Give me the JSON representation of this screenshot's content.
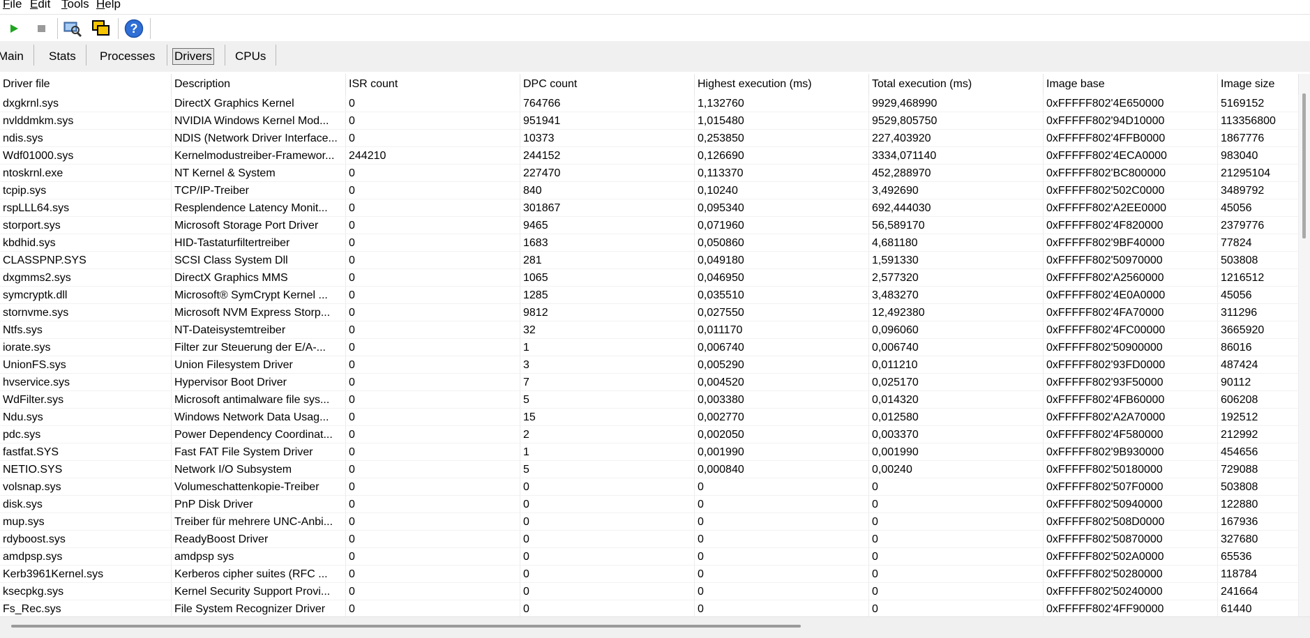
{
  "menu": [
    {
      "accel": "F",
      "rest": "ile"
    },
    {
      "accel": "E",
      "rest": "dit"
    },
    {
      "accel": "T",
      "rest": "ools"
    },
    {
      "accel": "H",
      "rest": "elp"
    }
  ],
  "toolbar": {
    "icons": [
      "play-icon",
      "stop-icon",
      "search-tool-icon",
      "windows-icon",
      "help-icon"
    ],
    "colors": {
      "play": "#1fa51f",
      "stop": "#9a9a9a",
      "help": "#2f6fd6"
    },
    "help_glyph": "?"
  },
  "tabs": [
    {
      "label": "Main",
      "selected": false
    },
    {
      "label": "Stats",
      "selected": false
    },
    {
      "label": "Processes",
      "selected": false
    },
    {
      "label": "Drivers",
      "selected": true
    },
    {
      "label": "CPUs",
      "selected": false
    }
  ],
  "table": {
    "columns": [
      "Driver file",
      "Description",
      "ISR count",
      "DPC count",
      "Highest execution (ms)",
      "Total execution (ms)",
      "Image base",
      "Image size"
    ],
    "rows": [
      [
        "dxgkrnl.sys",
        "DirectX Graphics Kernel",
        "0",
        "764766",
        "1,132760",
        "9929,468990",
        "0xFFFFF802'4E650000",
        "5169152"
      ],
      [
        "nvlddmkm.sys",
        "NVIDIA Windows Kernel Mod...",
        "0",
        "951941",
        "1,015480",
        "9529,805750",
        "0xFFFFF802'94D10000",
        "113356800"
      ],
      [
        "ndis.sys",
        "NDIS (Network Driver Interface...",
        "0",
        "10373",
        "0,253850",
        "227,403920",
        "0xFFFFF802'4FFB0000",
        "1867776"
      ],
      [
        "Wdf01000.sys",
        "Kernelmodustreiber-Framewor...",
        "244210",
        "244152",
        "0,126690",
        "3334,071140",
        "0xFFFFF802'4ECA0000",
        "983040"
      ],
      [
        "ntoskrnl.exe",
        "NT Kernel & System",
        "0",
        "227470",
        "0,113370",
        "452,288970",
        "0xFFFFF802'BC800000",
        "21295104"
      ],
      [
        "tcpip.sys",
        "TCP/IP-Treiber",
        "0",
        "840",
        "0,10240",
        "3,492690",
        "0xFFFFF802'502C0000",
        "3489792"
      ],
      [
        "rspLLL64.sys",
        "Resplendence Latency Monit...",
        "0",
        "301867",
        "0,095340",
        "692,444030",
        "0xFFFFF802'A2EE0000",
        "45056"
      ],
      [
        "storport.sys",
        "Microsoft Storage Port Driver",
        "0",
        "9465",
        "0,071960",
        "56,589170",
        "0xFFFFF802'4F820000",
        "2379776"
      ],
      [
        "kbdhid.sys",
        "HID-Tastaturfiltertreiber",
        "0",
        "1683",
        "0,050860",
        "4,681180",
        "0xFFFFF802'9BF40000",
        "77824"
      ],
      [
        "CLASSPNP.SYS",
        "SCSI Class System Dll",
        "0",
        "281",
        "0,049180",
        "1,591330",
        "0xFFFFF802'50970000",
        "503808"
      ],
      [
        "dxgmms2.sys",
        "DirectX Graphics MMS",
        "0",
        "1065",
        "0,046950",
        "2,577320",
        "0xFFFFF802'A2560000",
        "1216512"
      ],
      [
        "symcryptk.dll",
        "Microsoft® SymCrypt Kernel ...",
        "0",
        "1285",
        "0,035510",
        "3,483270",
        "0xFFFFF802'4E0A0000",
        "45056"
      ],
      [
        "stornvme.sys",
        "Microsoft NVM Express Storp...",
        "0",
        "9812",
        "0,027550",
        "12,492380",
        "0xFFFFF802'4FA70000",
        "311296"
      ],
      [
        "Ntfs.sys",
        "NT-Dateisystemtreiber",
        "0",
        "32",
        "0,011170",
        "0,096060",
        "0xFFFFF802'4FC00000",
        "3665920"
      ],
      [
        "iorate.sys",
        "Filter zur Steuerung der E/A-...",
        "0",
        "1",
        "0,006740",
        "0,006740",
        "0xFFFFF802'50900000",
        "86016"
      ],
      [
        "UnionFS.sys",
        "Union Filesystem Driver",
        "0",
        "3",
        "0,005290",
        "0,011210",
        "0xFFFFF802'93FD0000",
        "487424"
      ],
      [
        "hvservice.sys",
        "Hypervisor Boot Driver",
        "0",
        "7",
        "0,004520",
        "0,025170",
        "0xFFFFF802'93F50000",
        "90112"
      ],
      [
        "WdFilter.sys",
        "Microsoft antimalware file sys...",
        "0",
        "5",
        "0,003380",
        "0,014320",
        "0xFFFFF802'4FB60000",
        "606208"
      ],
      [
        "Ndu.sys",
        "Windows Network Data Usag...",
        "0",
        "15",
        "0,002770",
        "0,012580",
        "0xFFFFF802'A2A70000",
        "192512"
      ],
      [
        "pdc.sys",
        "Power Dependency Coordinat...",
        "0",
        "2",
        "0,002050",
        "0,003370",
        "0xFFFFF802'4F580000",
        "212992"
      ],
      [
        "fastfat.SYS",
        "Fast FAT File System Driver",
        "0",
        "1",
        "0,001990",
        "0,001990",
        "0xFFFFF802'9B930000",
        "454656"
      ],
      [
        "NETIO.SYS",
        "Network I/O Subsystem",
        "0",
        "5",
        "0,000840",
        "0,00240",
        "0xFFFFF802'50180000",
        "729088"
      ],
      [
        "volsnap.sys",
        "Volumeschattenkopie-Treiber",
        "0",
        "0",
        "0",
        "0",
        "0xFFFFF802'507F0000",
        "503808"
      ],
      [
        "disk.sys",
        "PnP Disk Driver",
        "0",
        "0",
        "0",
        "0",
        "0xFFFFF802'50940000",
        "122880"
      ],
      [
        "mup.sys",
        "Treiber für mehrere UNC-Anbi...",
        "0",
        "0",
        "0",
        "0",
        "0xFFFFF802'508D0000",
        "167936"
      ],
      [
        "rdyboost.sys",
        "ReadyBoost Driver",
        "0",
        "0",
        "0",
        "0",
        "0xFFFFF802'50870000",
        "327680"
      ],
      [
        "amdpsp.sys",
        "amdpsp sys",
        "0",
        "0",
        "0",
        "0",
        "0xFFFFF802'502A0000",
        "65536"
      ],
      [
        "Kerb3961Kernel.sys",
        "Kerberos cipher suites (RFC ...",
        "0",
        "0",
        "0",
        "0",
        "0xFFFFF802'50280000",
        "118784"
      ],
      [
        "ksecpkg.sys",
        "Kernel Security Support Provi...",
        "0",
        "0",
        "0",
        "0",
        "0xFFFFF802'50240000",
        "241664"
      ],
      [
        "Fs_Rec.sys",
        "File System Recognizer Driver",
        "0",
        "0",
        "0",
        "0",
        "0xFFFFF802'4FF90000",
        "61440"
      ]
    ]
  }
}
